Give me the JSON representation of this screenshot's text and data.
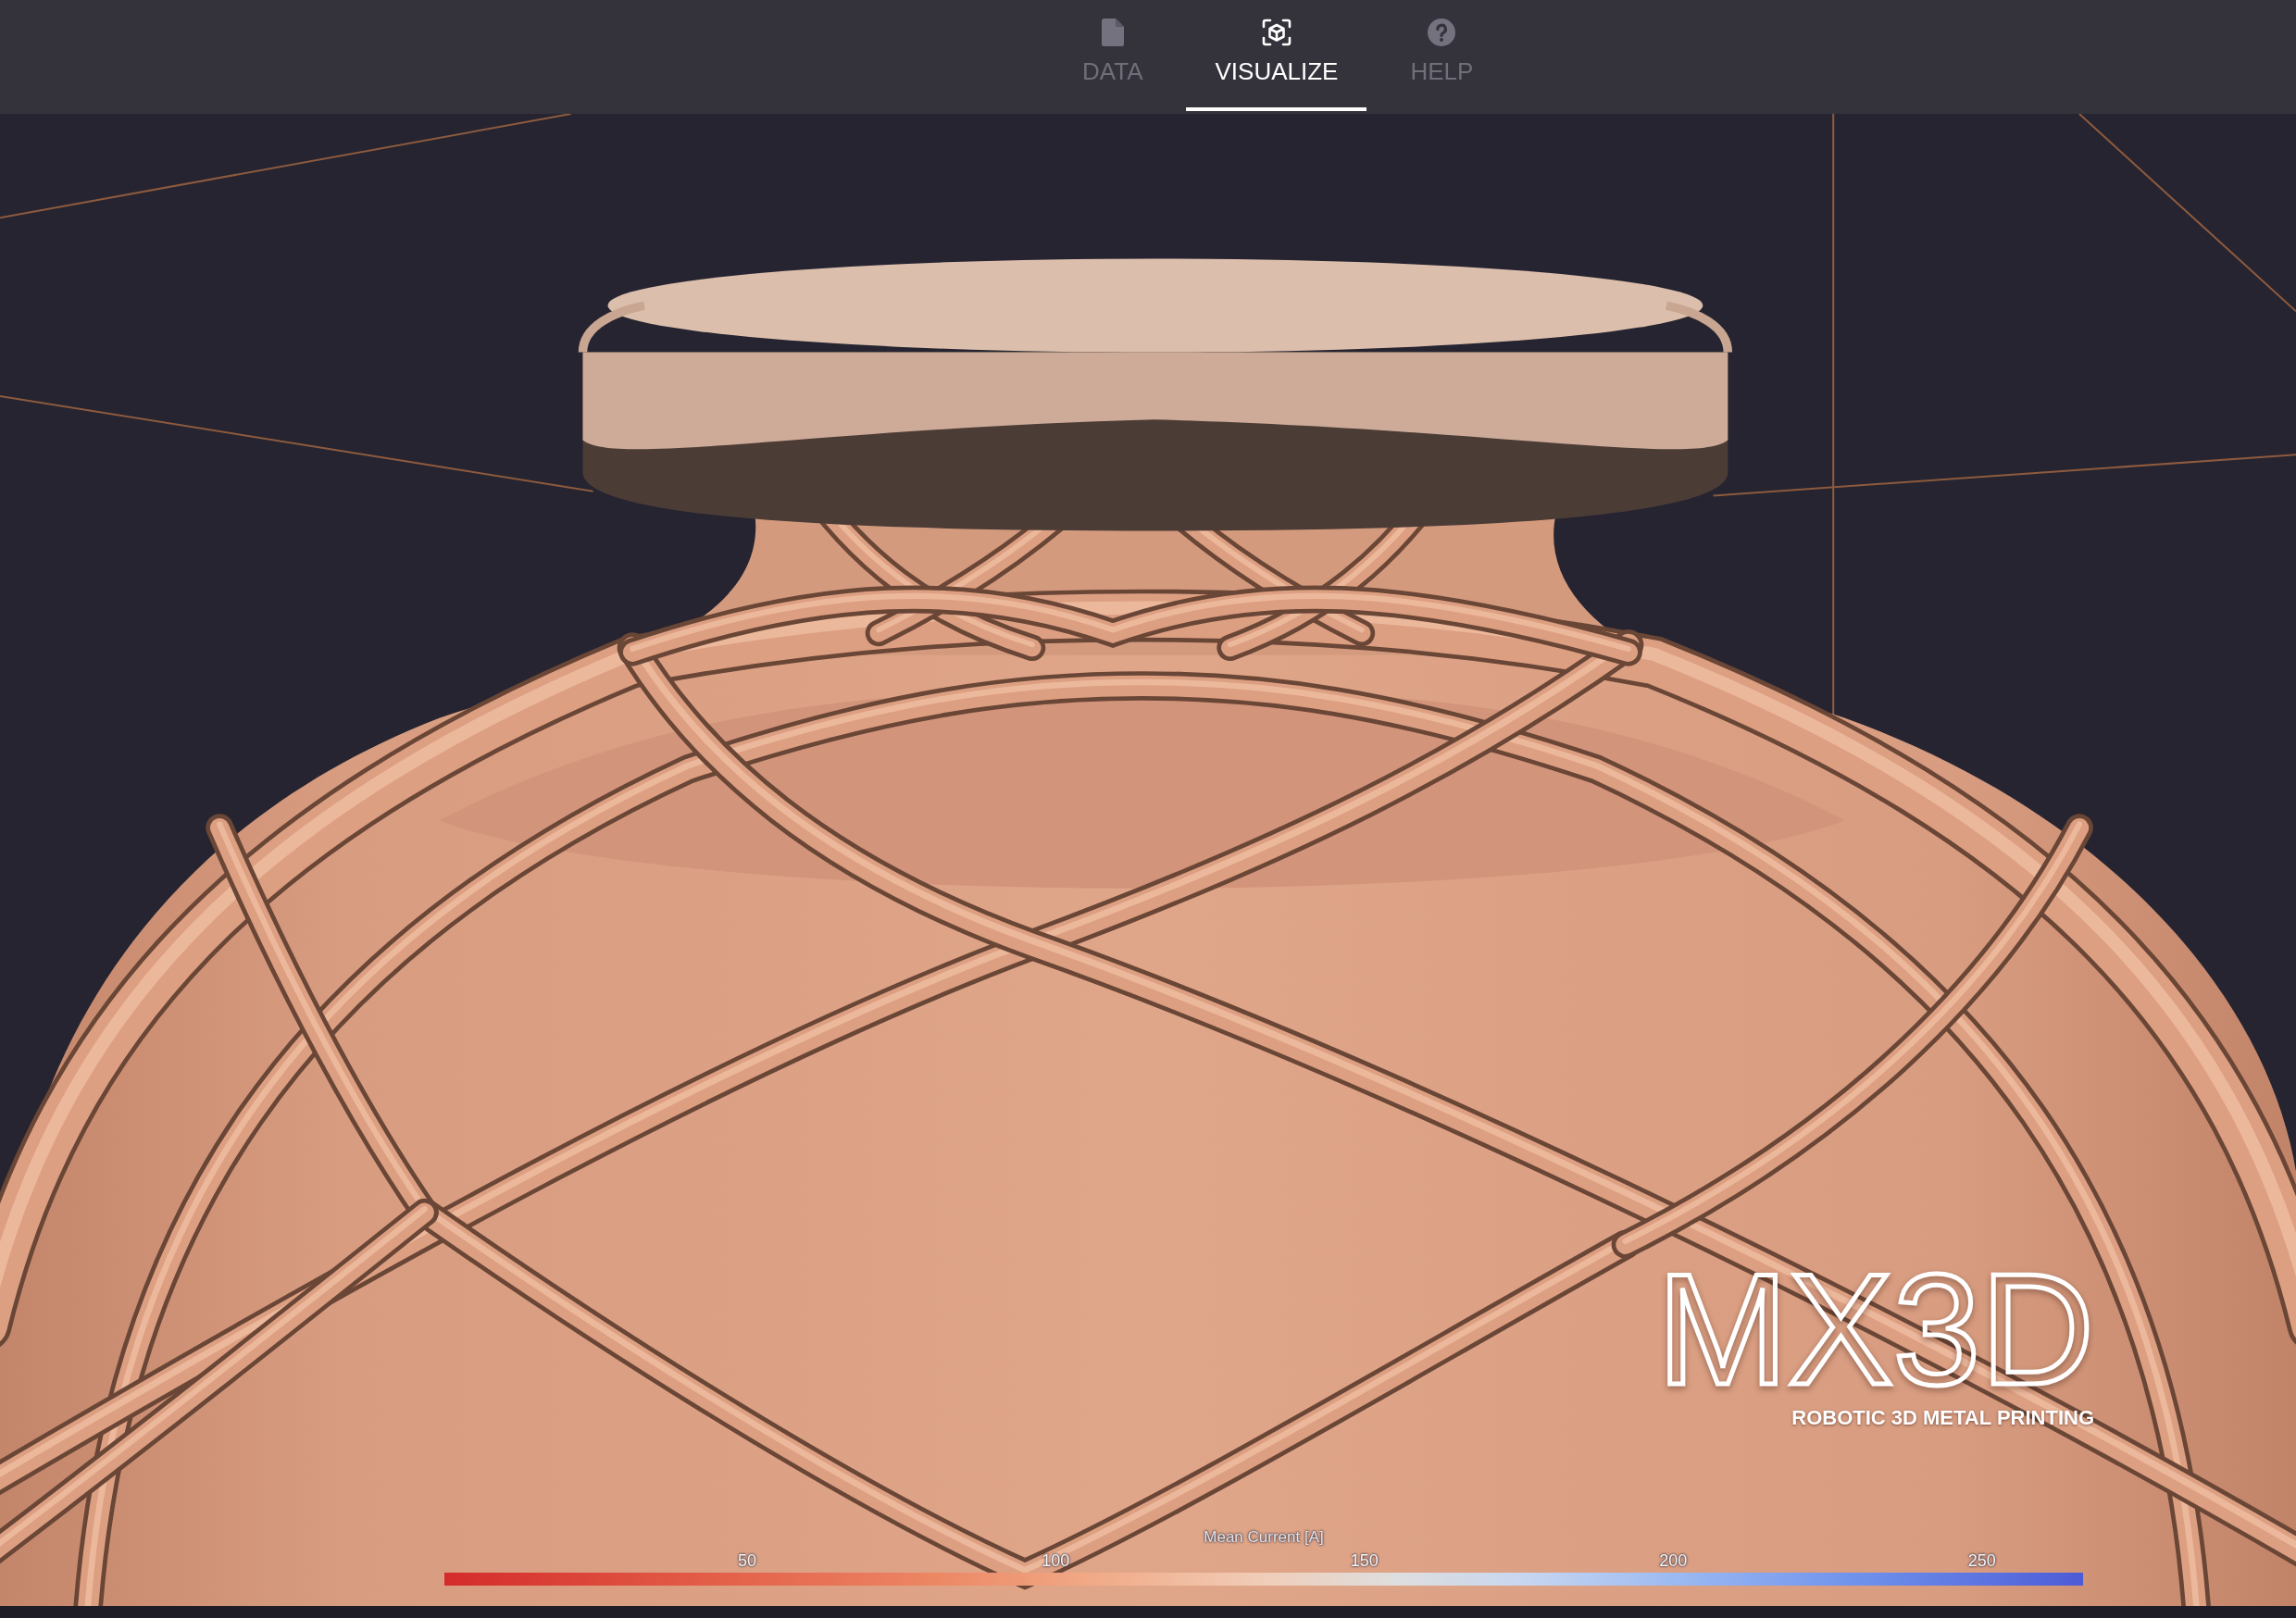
{
  "tabs": [
    {
      "label": "DATA",
      "selected": false
    },
    {
      "label": "VISUALIZE",
      "selected": true
    },
    {
      "label": "HELP",
      "selected": false
    }
  ],
  "viewport": {
    "logo": {
      "wordmark": "MX3D",
      "tagline": "ROBOTIC 3D METAL PRINTING"
    },
    "color_legend": {
      "title": "Mean Current [A]",
      "ticks": [
        "50",
        "100",
        "150",
        "200",
        "250"
      ]
    }
  }
}
